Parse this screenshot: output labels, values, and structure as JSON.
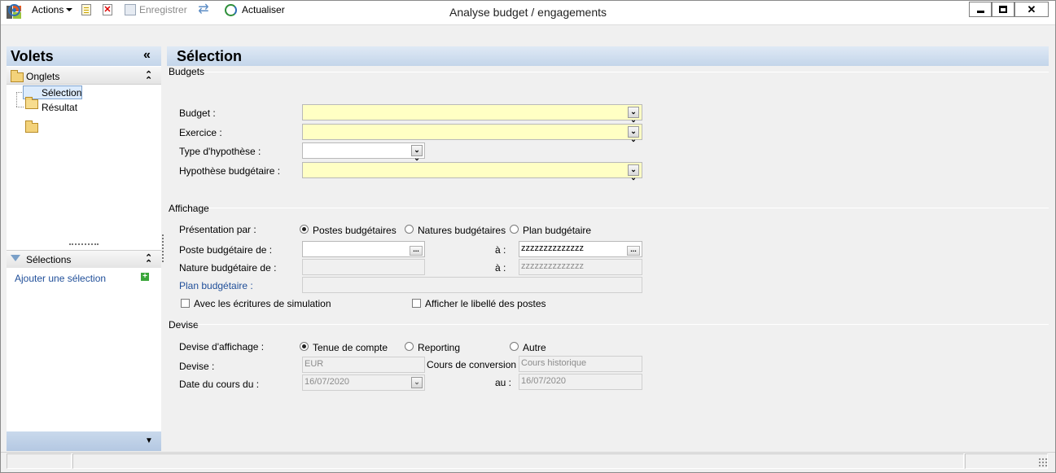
{
  "window": {
    "title": "Analyse budget / engagements"
  },
  "toolbar": {
    "actions_label": "Actions",
    "save_label": "Enregistrer",
    "refresh_label": "Actualiser"
  },
  "left_panel": {
    "title": "Volets",
    "collapse_glyph": "«",
    "onglets_label": "Onglets",
    "tree": [
      "Sélection",
      "Résultat"
    ],
    "selections_label": "Sélections",
    "add_selection_label": "Ajouter une sélection",
    "add_glyph": "+"
  },
  "main": {
    "title": "Sélection",
    "budgets": {
      "title": "Budgets",
      "budget_label": "Budget :",
      "exercice_label": "Exercice :",
      "type_label": "Type d'hypothèse :",
      "hypothese_label": "Hypothèse budgétaire :"
    },
    "affichage": {
      "title": "Affichage",
      "presentation_label": "Présentation par :",
      "radio_postes": "Postes budgétaires",
      "radio_natures": "Natures budgétaires",
      "radio_plan": "Plan budgétaire",
      "poste_de_label": "Poste budgétaire de :",
      "a_label": "à :",
      "poste_a_value": "zzzzzzzzzzzzzz",
      "nature_de_label": "Nature budgétaire de :",
      "nature_a_value": "zzzzzzzzzzzzzz",
      "plan_label": "Plan budgétaire :",
      "chk_simulation": "Avec les écritures de simulation",
      "chk_libelle": "Afficher le libellé des postes"
    },
    "devise": {
      "title": "Devise",
      "affichage_label": "Devise d'affichage :",
      "radio_tenue": "Tenue de compte",
      "radio_reporting": "Reporting",
      "radio_autre": "Autre",
      "devise_label": "Devise :",
      "devise_value": "EUR",
      "cours_label": "Cours de conversion :",
      "cours_value": "Cours historique",
      "date_label": "Date du cours du :",
      "date_value": "16/07/2020",
      "au_label": "au :",
      "au_value": "16/07/2020"
    }
  },
  "icons": {
    "dropdown": "⏷",
    "ellipsis": "...",
    "collapse_up": "⌃",
    "collapse_down": "▾"
  }
}
